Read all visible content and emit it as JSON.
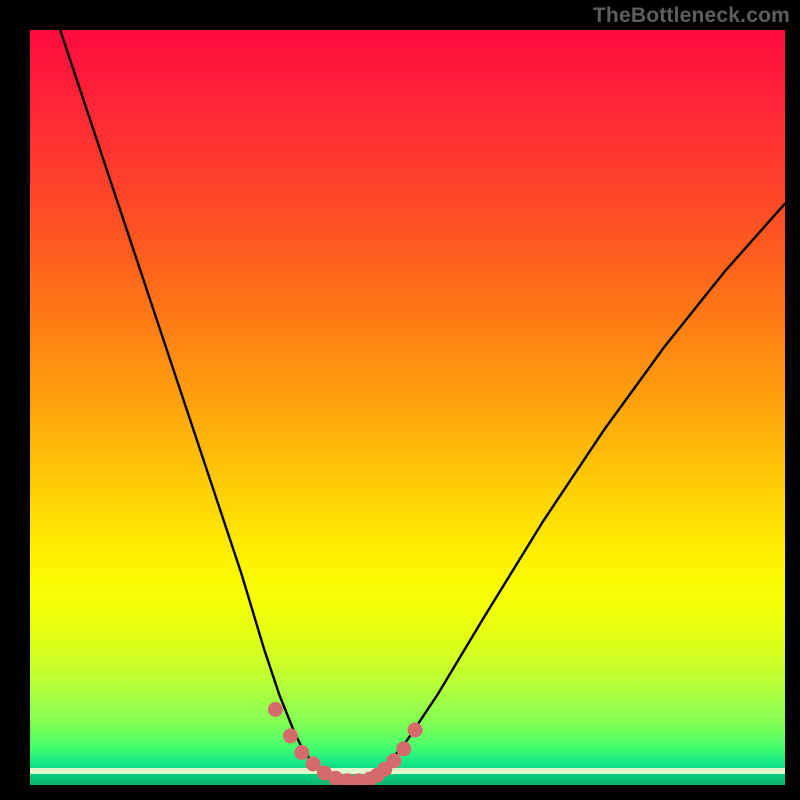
{
  "brand": "TheBottleneck.com",
  "colors": {
    "background": "#000000",
    "curve_stroke": "#000000",
    "marker_fill": "#d46a6a",
    "brand_text": "#5e5e5e"
  },
  "chart_data": {
    "type": "line",
    "title": "",
    "xlabel": "",
    "ylabel": "",
    "xlim": [
      0,
      100
    ],
    "ylim": [
      0,
      100
    ],
    "grid": false,
    "legend": false,
    "series": [
      {
        "name": "left-branch",
        "x": [
          4,
          8,
          12,
          16,
          20,
          24,
          28,
          31,
          33,
          35,
          36,
          37,
          38,
          39,
          40
        ],
        "y": [
          100,
          88,
          76,
          64,
          52,
          40,
          28,
          18,
          12,
          7,
          5,
          3.5,
          2.2,
          1.3,
          0.8
        ]
      },
      {
        "name": "right-branch",
        "x": [
          45,
          46,
          47,
          48,
          50,
          54,
          60,
          68,
          76,
          84,
          92,
          100
        ],
        "y": [
          0.8,
          1.3,
          2.2,
          3.5,
          6,
          12,
          22,
          35,
          47,
          58,
          68,
          77
        ]
      },
      {
        "name": "valley-floor",
        "x": [
          40,
          41,
          42,
          43,
          44,
          45
        ],
        "y": [
          0.8,
          0.6,
          0.55,
          0.55,
          0.6,
          0.8
        ]
      }
    ],
    "markers": {
      "name": "highlight-points",
      "x": [
        32.5,
        34.5,
        36,
        37.5,
        39,
        40.5,
        42,
        43.5,
        45,
        46,
        47,
        48.2,
        49.5,
        51
      ],
      "y": [
        10,
        6.5,
        4.3,
        2.8,
        1.6,
        0.9,
        0.55,
        0.55,
        0.8,
        1.3,
        2.1,
        3.2,
        4.8,
        7.3
      ]
    }
  }
}
